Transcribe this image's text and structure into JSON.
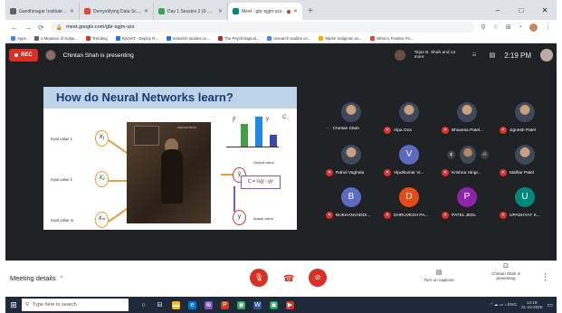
{
  "browser": {
    "tabs": [
      {
        "title": "Gandhinagar Institute of Technology",
        "color": "#5f6368",
        "active": false
      },
      {
        "title": "Demystifying Data Science usi...",
        "color": "#ea4335",
        "active": false
      },
      {
        "title": "Day 1 Session 2 (0: Adjust A...",
        "color": "#34a853",
        "active": false
      },
      {
        "title": "Meet - gbr-sgjm-xzs",
        "color": "#00897b",
        "active": true
      }
    ],
    "new_tab": "+",
    "window_controls": [
      "–",
      "□",
      "✕"
    ],
    "nav": {
      "back": "←",
      "forward": "→",
      "reload": "⟳"
    },
    "url": "meet.google.com/gbr-sgjm-xzs",
    "right_icons": [
      "⚲",
      "☆",
      "⊞",
      "◔",
      "⋮"
    ],
    "bookmarks": [
      {
        "label": "Apps",
        "color": "#4285f4"
      },
      {
        "label": "A Measure of Subje...",
        "color": "#5f6368"
      },
      {
        "label": "Trending",
        "color": "#d93025"
      },
      {
        "label": "RycVAT - Deploy R...",
        "color": "#1a73e8"
      },
      {
        "label": "research studies on...",
        "color": "#1a73e8"
      },
      {
        "label": "The Psychological...",
        "color": "#c5221f"
      },
      {
        "label": "research studies on...",
        "color": "#4285f4"
      },
      {
        "label": "Martin Seligman on...",
        "color": "#f9ab00"
      },
      {
        "label": "What is Positive Ps...",
        "color": "#ea4335"
      }
    ]
  },
  "meet": {
    "rec_label": "REC",
    "presenter_text": "Chintan Shah is presenting",
    "joined_text": "Tejas B. Shah and 14 more",
    "clock": "2:19 PM",
    "participant_count_icon": "☷"
  },
  "slide": {
    "title": "How do Neural Networks learn?",
    "inputs": [
      {
        "label": "Input value 1",
        "node": "X₁"
      },
      {
        "label": "Input value 2",
        "node": "X₂"
      },
      {
        "label": "Input value m",
        "node": "Xₘ"
      }
    ],
    "photo_caption": "PERCEPTRON",
    "chart_labels": {
      "y_hat": "ŷ",
      "y": "y",
      "c": "C"
    },
    "output_node": "ŷ",
    "output_label": "Output value",
    "error_formula": "C = ½(ŷ - y)²",
    "actual_node": "y",
    "actual_label": "Actual value"
  },
  "participants": [
    {
      "name": "Chintan Shah",
      "muted": false,
      "avatar_type": "photo",
      "avatar_text": "",
      "color": "#455a64"
    },
    {
      "name": "Alpa Oza",
      "muted": true,
      "avatar_type": "photo",
      "avatar_text": "",
      "color": "#455a64"
    },
    {
      "name": "Bhavesa Patel...",
      "muted": true,
      "avatar_type": "photo",
      "avatar_text": "",
      "color": "#455a64"
    },
    {
      "name": "Jignesh Patel",
      "muted": true,
      "avatar_type": "photo",
      "avatar_text": "",
      "color": "#455a64"
    },
    {
      "name": "Rahul Vaghela",
      "muted": true,
      "avatar_type": "photo",
      "avatar_text": "",
      "color": "#455a64"
    },
    {
      "name": "Vipulkumar Vi...",
      "muted": true,
      "avatar_type": "letter",
      "avatar_text": "V",
      "color": "#5c6bc0"
    },
    {
      "name": "Krishna Hingr...",
      "muted": true,
      "avatar_type": "pinned",
      "avatar_text": "",
      "color": "#3c4043"
    },
    {
      "name": "Malhar Patel",
      "muted": true,
      "avatar_type": "photo",
      "avatar_text": "",
      "color": "#455a64"
    },
    {
      "name": "BUKHANVADDI...",
      "muted": true,
      "avatar_type": "letter",
      "avatar_text": "B",
      "color": "#5c6bc0"
    },
    {
      "name": "DHRUVESH PA...",
      "muted": true,
      "avatar_type": "letter",
      "avatar_text": "D",
      "color": "#e64a19"
    },
    {
      "name": "PATEL JEEL",
      "muted": true,
      "avatar_type": "letter",
      "avatar_text": "P",
      "color": "#8e24aa"
    },
    {
      "name": "UPADHYAY K...",
      "muted": true,
      "avatar_type": "letter",
      "avatar_text": "U",
      "color": "#00897b"
    }
  ],
  "controls": {
    "meeting_details": "Meeting details",
    "chevron": "^",
    "mic_icon": "🎙",
    "hangup_icon": "☎",
    "camera_icon": "⊘",
    "captions_label": "Turn on captions",
    "captions_icon": "▤",
    "present_label": "Chintan Shah is presenting",
    "present_icon": "⊡",
    "more_icon": "⋮"
  },
  "taskbar": {
    "start_icon": "⊞",
    "search_placeholder": "Type here to search",
    "search_icon": "⚲",
    "apps": [
      {
        "glyph": "○",
        "bg": "transparent"
      },
      {
        "glyph": "⊟",
        "bg": "transparent"
      },
      {
        "glyph": "▬",
        "bg": "#ffb900"
      },
      {
        "glyph": "e",
        "bg": "#0078d7"
      },
      {
        "glyph": "⊛",
        "bg": "#7e57c2"
      },
      {
        "glyph": "P",
        "bg": "#c43e1c"
      },
      {
        "glyph": "◉",
        "bg": "#34a853"
      },
      {
        "glyph": "W",
        "bg": "#2b579a"
      },
      {
        "glyph": "▣",
        "bg": "#0f9d58"
      },
      {
        "glyph": "▶",
        "bg": "#d93025"
      }
    ],
    "tray_text": "^ ☁ ▭ ♪ ENG",
    "time": "14:19",
    "date": "21-10-2020",
    "notification_icon": "▭"
  }
}
